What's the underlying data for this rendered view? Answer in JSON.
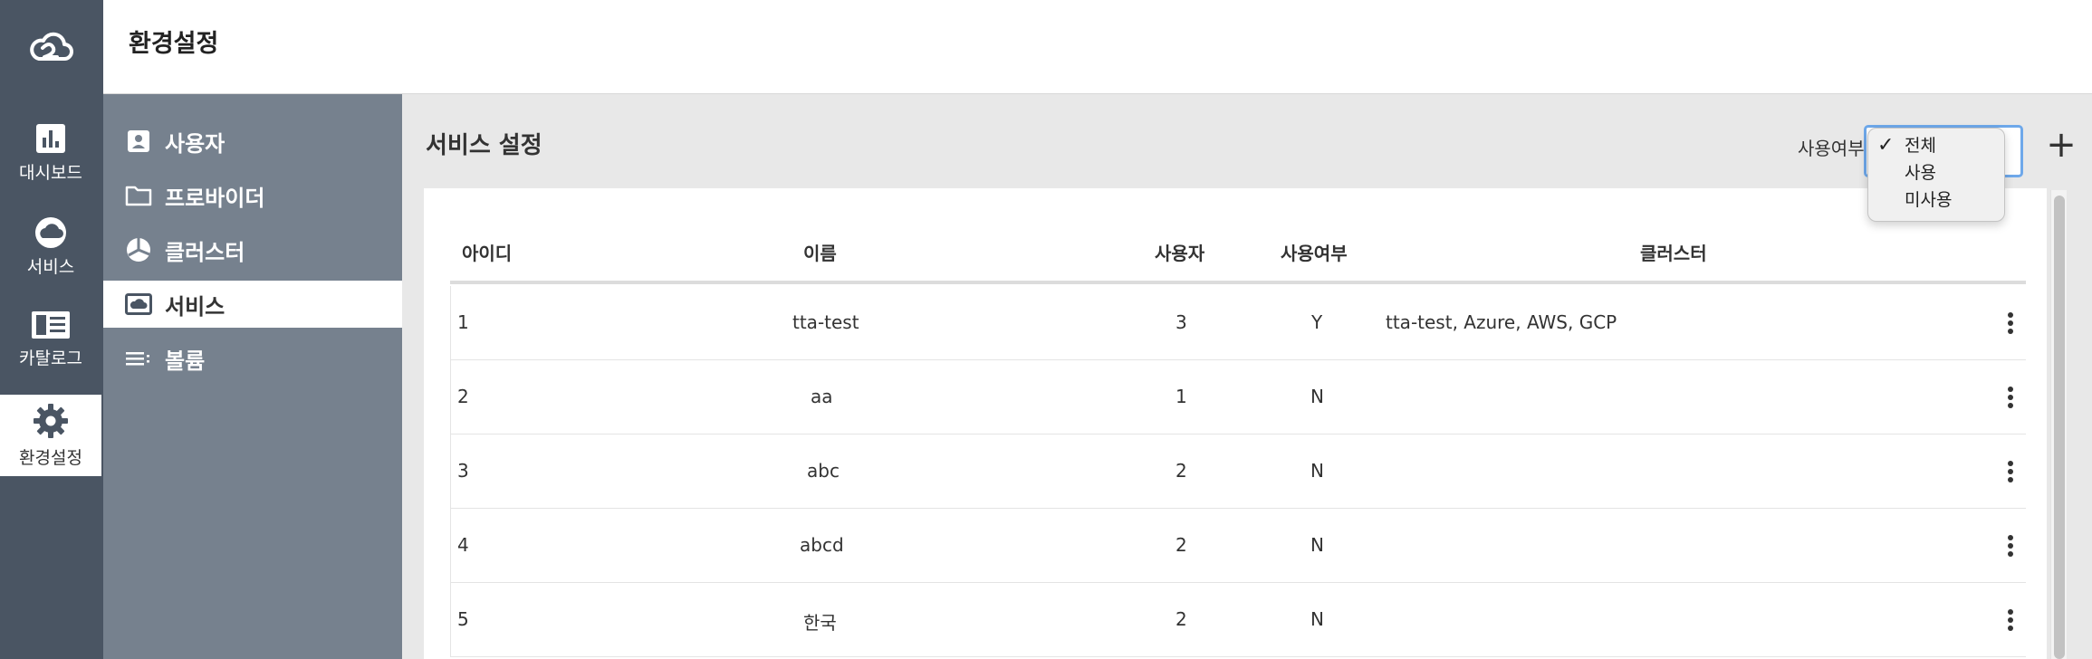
{
  "header": {
    "title": "환경설정"
  },
  "rail": [
    {
      "label": "대시보드",
      "icon": "dashboard-icon"
    },
    {
      "label": "서비스",
      "icon": "cloud-icon"
    },
    {
      "label": "카탈로그",
      "icon": "catalog-icon"
    },
    {
      "label": "환경설정",
      "icon": "gear-icon",
      "active": true
    }
  ],
  "submenu": [
    {
      "label": "사용자",
      "icon": "user-icon"
    },
    {
      "label": "프로바이더",
      "icon": "folder-icon"
    },
    {
      "label": "클러스터",
      "icon": "pie-chart-icon"
    },
    {
      "label": "서비스",
      "icon": "cloud-image-icon",
      "active": true
    },
    {
      "label": "볼륨",
      "icon": "list-icon"
    }
  ],
  "main": {
    "title": "서비스 설정",
    "filter_label": "사용여부",
    "add_icon": "plus-icon",
    "dropdown_options": [
      "전체",
      "사용",
      "미사용"
    ],
    "dropdown_selected": "전체"
  },
  "table": {
    "headers": {
      "id": "아이디",
      "name": "이름",
      "users": "사용자",
      "in_use": "사용여부",
      "cluster": "클러스터"
    },
    "rows": [
      {
        "id": "1",
        "name": "tta-test",
        "users": "3",
        "in_use": "Y",
        "cluster": "tta-test, Azure, AWS, GCP"
      },
      {
        "id": "2",
        "name": "aa",
        "users": "1",
        "in_use": "N",
        "cluster": ""
      },
      {
        "id": "3",
        "name": "abc",
        "users": "2",
        "in_use": "N",
        "cluster": ""
      },
      {
        "id": "4",
        "name": "abcd",
        "users": "2",
        "in_use": "N",
        "cluster": ""
      },
      {
        "id": "5",
        "name": "한국",
        "users": "2",
        "in_use": "N",
        "cluster": ""
      }
    ]
  },
  "colors": {
    "rail_bg": "#4a5563",
    "submenu_bg": "#76818e",
    "select_border": "#6ea8ea",
    "main_bg": "#e8e8e8"
  }
}
